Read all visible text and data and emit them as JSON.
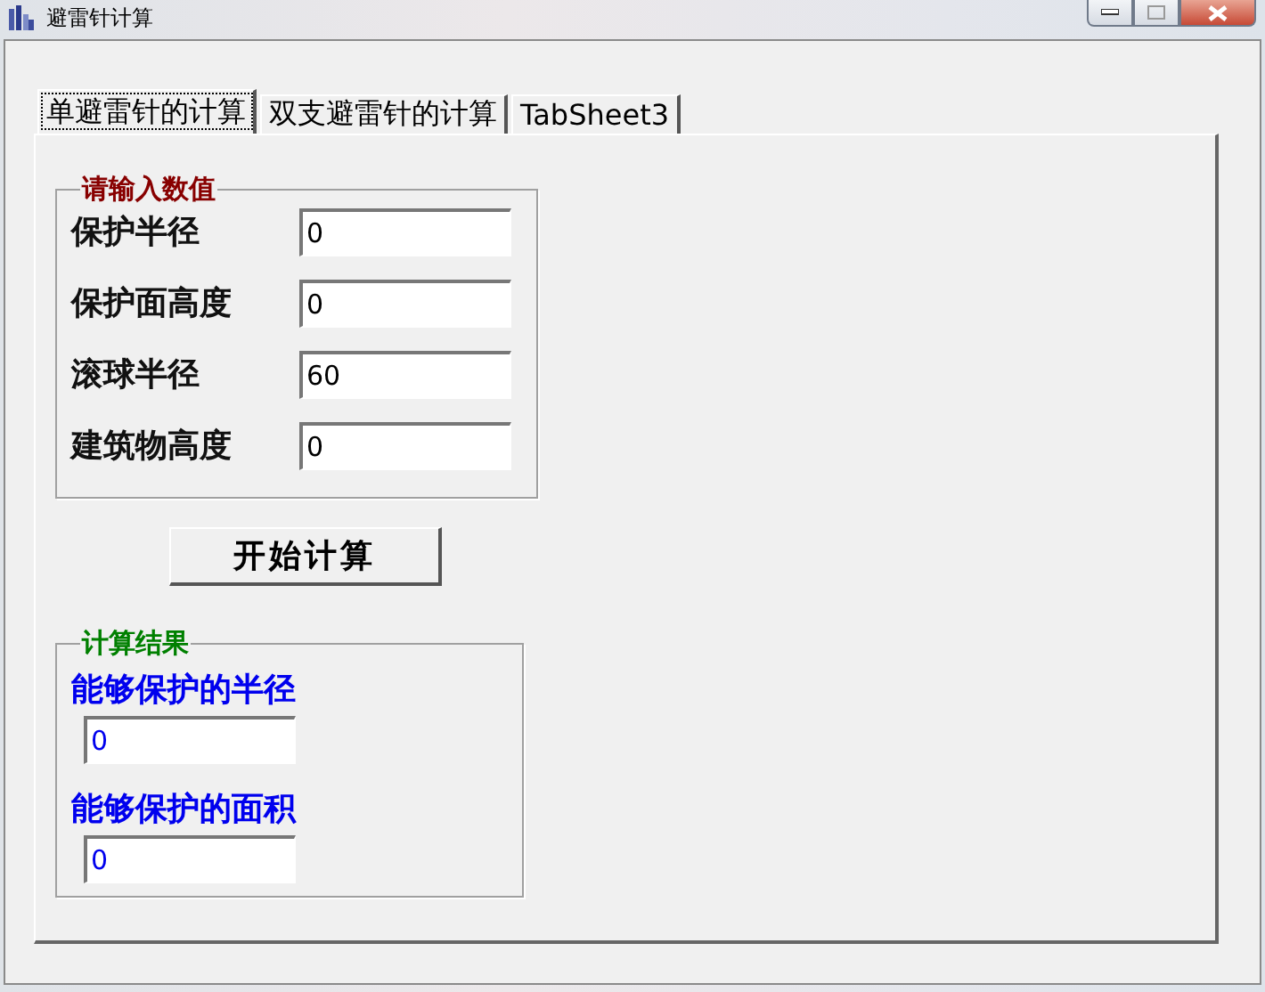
{
  "window": {
    "title": "避雷针计算",
    "controls": [
      {
        "kind": "minimize"
      },
      {
        "kind": "maximize"
      },
      {
        "kind": "close"
      }
    ]
  },
  "tabs": [
    {
      "label": "单避雷针的计算",
      "selected": true
    },
    {
      "label": "双支避雷针的计算",
      "selected": false
    },
    {
      "label": "TabSheet3",
      "selected": false
    }
  ],
  "input_group": {
    "title": "请输入数值",
    "fields": [
      {
        "label": "保护半径",
        "value": "0"
      },
      {
        "label": "保护面高度",
        "value": "0"
      },
      {
        "label": "滚球半径",
        "value": "60"
      },
      {
        "label": "建筑物高度",
        "value": "0"
      }
    ]
  },
  "start_button": "开始计算",
  "result_group": {
    "title": "计算结果",
    "fields": [
      {
        "label": "能够保护的半径",
        "value": "0"
      },
      {
        "label": "能够保护的面积",
        "value": "0"
      }
    ]
  }
}
